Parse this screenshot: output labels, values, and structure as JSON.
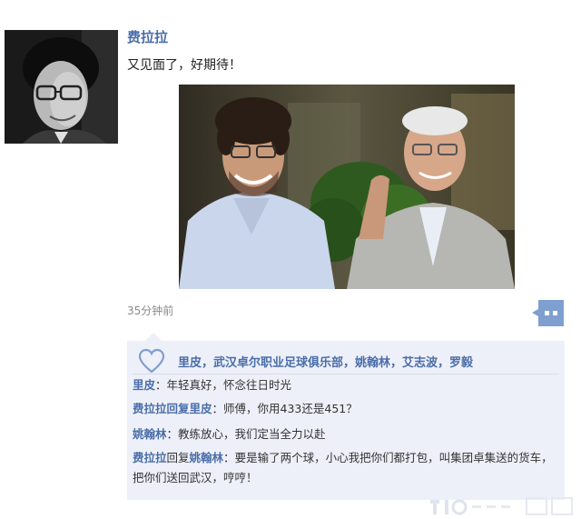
{
  "post": {
    "author": "费拉拉",
    "text": "又见面了，好期待！",
    "time": "35分钟前"
  },
  "likes": {
    "names": "里皮，武汉卓尔职业足球俱乐部，姚翰林，艾志波，罗毅"
  },
  "comments": [
    {
      "name": "里皮",
      "connector": "",
      "target": "",
      "sep": "：",
      "text": "年轻真好，怀念往日时光"
    },
    {
      "name": "费拉拉回复里皮",
      "connector": "",
      "target": "",
      "sep": "：",
      "text": "师傅，你用433还是451？"
    },
    {
      "name": "姚翰林",
      "connector": "",
      "target": "",
      "sep": "：",
      "text": "教练放心，我们定当全力以赴"
    },
    {
      "name": "费拉拉",
      "connector": "回复",
      "target": "姚翰林",
      "sep": "：",
      "text": "要是输了两个球，小心我把你们都打包，叫集团卓集送的货车，把你们送回武汉，哼哼！"
    }
  ],
  "icons": {
    "avatar": "profile-photo",
    "photo": "two-men-smiling-photo",
    "comment": "comment-bubble-icon",
    "like": "heart-outline-icon"
  },
  "colors": {
    "link": "#4a6ea9",
    "panel": "#eef0f9",
    "button": "#7f9fd0"
  }
}
